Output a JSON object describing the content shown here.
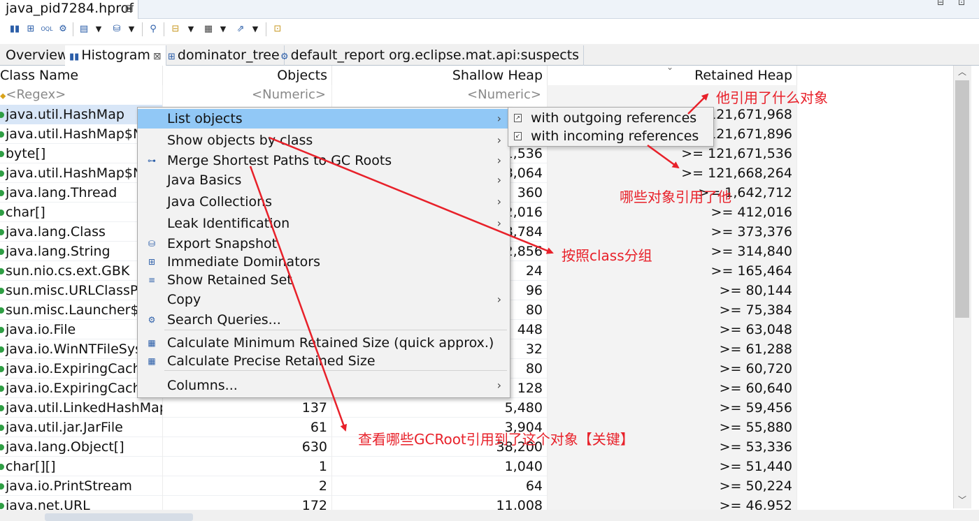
{
  "editor": {
    "tab_title": "java_pid7284.hprof",
    "tab_close": "⊠"
  },
  "window_controls": {
    "restore": "⊟",
    "close": "⊡"
  },
  "page_tabs": {
    "overview": "Overview",
    "histogram": "Histogram",
    "histogram_close": "⊠",
    "dominator_tree": "dominator_tree",
    "default_report": "default_report  org.eclipse.mat.api:suspects"
  },
  "table": {
    "headers": {
      "class_name": "Class Name",
      "objects": "Objects",
      "shallow_heap": "Shallow Heap",
      "retained_heap": "Retained Heap"
    },
    "filters": {
      "class_name": "<Regex>",
      "objects": "<Numeric>",
      "shallow_heap": "<Numeric>",
      "retained_heap": ""
    },
    "rows": [
      {
        "name": "java.util.HashMap",
        "objects": "",
        "shallow": "",
        "retained": "121,671,968"
      },
      {
        "name": "java.util.HashMap$Nc",
        "objects": "",
        "shallow": "",
        "retained": "121,671,896"
      },
      {
        "name": "byte[]",
        "objects": "",
        "shallow": "1,536",
        "retained": ">= 121,671,536"
      },
      {
        "name": "java.util.HashMap$Nc",
        "objects": "",
        "shallow": "8,064",
        "retained": ">= 121,668,264"
      },
      {
        "name": "java.lang.Thread",
        "objects": "",
        "shallow": "360",
        "retained": ">= 1,642,712"
      },
      {
        "name": "char[]",
        "objects": "",
        "shallow": "2,016",
        "retained": ">= 412,016"
      },
      {
        "name": "java.lang.Class",
        "objects": "",
        "shallow": "8,784",
        "retained": ">= 373,376"
      },
      {
        "name": "java.lang.String",
        "objects": "",
        "shallow": "2,856",
        "retained": ">= 314,840"
      },
      {
        "name": "sun.nio.cs.ext.GBK",
        "objects": "",
        "shallow": "24",
        "retained": ">= 165,464"
      },
      {
        "name": "sun.misc.URLClassPath",
        "objects": "",
        "shallow": "96",
        "retained": ">= 80,144"
      },
      {
        "name": "sun.misc.Launcher$Ap",
        "objects": "",
        "shallow": "80",
        "retained": ">= 75,384"
      },
      {
        "name": "java.io.File",
        "objects": "",
        "shallow": "448",
        "retained": ">= 63,048"
      },
      {
        "name": "java.io.WinNTFileSyste",
        "objects": "",
        "shallow": "32",
        "retained": ">= 61,288"
      },
      {
        "name": "java.io.ExpiringCache",
        "objects": "",
        "shallow": "80",
        "retained": ">= 60,720"
      },
      {
        "name": "java.io.ExpiringCache$",
        "objects": "",
        "shallow": "128",
        "retained": ">= 60,640"
      },
      {
        "name": "java.util.LinkedHashMap...",
        "objects": "137",
        "shallow": "5,480",
        "retained": ">= 59,456"
      },
      {
        "name": "java.util.jar.JarFile",
        "objects": "61",
        "shallow": "3,904",
        "retained": ">= 55,880"
      },
      {
        "name": "java.lang.Object[]",
        "objects": "630",
        "shallow": "38,200",
        "retained": ">= 53,336"
      },
      {
        "name": "char[][]",
        "objects": "1",
        "shallow": "1,040",
        "retained": ">= 51,440"
      },
      {
        "name": "java.io.PrintStream",
        "objects": "2",
        "shallow": "64",
        "retained": ">= 50,224"
      },
      {
        "name": "java.net.URL",
        "objects": "172",
        "shallow": "11,008",
        "retained": ">= 46,952"
      }
    ]
  },
  "context_menu": {
    "items": [
      {
        "label": "List objects",
        "icon": "",
        "submenu": true
      },
      {
        "label": "Show objects by class",
        "icon": "",
        "submenu": true
      },
      {
        "label": "Merge Shortest Paths to GC Roots",
        "icon": "paths-icon",
        "submenu": true
      },
      {
        "label": "Java Basics",
        "icon": "",
        "submenu": true
      },
      {
        "label": "Java Collections",
        "icon": "",
        "submenu": true
      },
      {
        "label": "Leak Identification",
        "icon": "",
        "submenu": true
      },
      {
        "label": "Export Snapshot",
        "icon": "export-icon",
        "submenu": false
      },
      {
        "label": "Immediate Dominators",
        "icon": "dominators-icon",
        "submenu": false
      },
      {
        "label": "Show Retained Set",
        "icon": "retained-set-icon",
        "submenu": false
      },
      {
        "label": "Copy",
        "icon": "",
        "submenu": true
      },
      {
        "label": "Search Queries...",
        "icon": "search-queries-icon",
        "submenu": false
      },
      {
        "label": "Calculate Minimum Retained Size (quick approx.)",
        "icon": "calculator-icon",
        "submenu": false
      },
      {
        "label": "Calculate Precise Retained Size",
        "icon": "calculator-icon",
        "submenu": false
      },
      {
        "label": "Columns...",
        "icon": "",
        "submenu": true
      }
    ],
    "submenu": {
      "outgoing": "with outgoing references",
      "incoming": "with incoming references"
    }
  },
  "annotations": {
    "outgoing_note": "他引用了什么对象",
    "incoming_note": "哪些对象引用了他",
    "by_class_note": "按照class分组",
    "gc_root_note": "查看哪些GCRoot引用到了这个对象【关键】",
    "color": "#e8212a"
  }
}
